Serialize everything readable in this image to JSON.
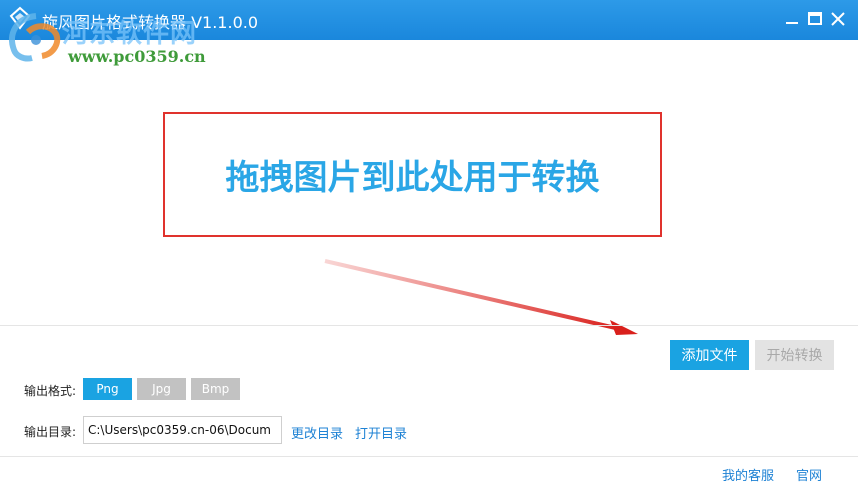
{
  "window": {
    "title": "旋风图片格式转换器 V1.1.0.0",
    "minimize_icon": "minimize-icon",
    "maximize_icon": "maximize-icon",
    "close_icon": "close-icon"
  },
  "watermark": {
    "brand": "河东软件网",
    "url": "www.pc0359.cn"
  },
  "drop": {
    "hint": "拖拽图片到此处用于转换"
  },
  "actions": {
    "add_files": "添加文件",
    "start_convert": "开始转换"
  },
  "output": {
    "format_label": "输出格式:",
    "formats": [
      {
        "label": "Png",
        "selected": true
      },
      {
        "label": "Jpg",
        "selected": false
      },
      {
        "label": "Bmp",
        "selected": false
      }
    ],
    "dir_label": "输出目录:",
    "dir_value": "C:\\Users\\pc0359.cn-06\\Docum",
    "change_dir": "更改目录",
    "open_dir": "打开目录"
  },
  "footer": {
    "support": "我的客服",
    "website": "官网"
  },
  "colors": {
    "titlebar": "#1a87dc",
    "accent": "#1aa3e2",
    "drop_border": "#e0322d",
    "drop_text": "#2aa6e6",
    "link": "#1e82d4",
    "format_selected": "#1aa3e2",
    "format_unselected": "#c2c2c2"
  }
}
